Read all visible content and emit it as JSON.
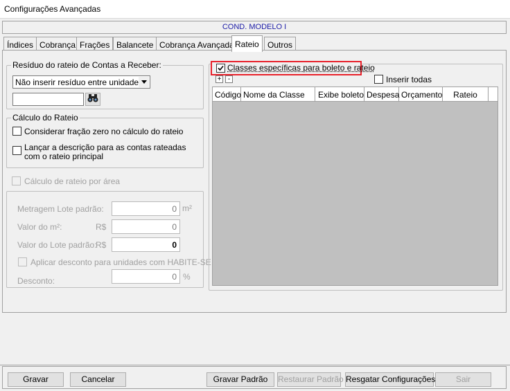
{
  "window": {
    "title": "Configurações Avançadas"
  },
  "condominium": {
    "name": "COND. MODELO I"
  },
  "tabs": [
    {
      "label": "Índices"
    },
    {
      "label": "Cobrança"
    },
    {
      "label": "Frações"
    },
    {
      "label": "Balancete"
    },
    {
      "label": "Cobrança Avançada"
    },
    {
      "label": "Rateio"
    },
    {
      "label": "Outros"
    }
  ],
  "residuo": {
    "legend": "Resíduo do rateio de Contas a Receber:",
    "selected": "Não inserir resíduo entre unidades",
    "search_value": ""
  },
  "calculo": {
    "legend": "Cálculo do Rateio",
    "fracao_zero": "Considerar fração zero no cálculo do rateio",
    "descricao_line1": "Lançar a descrição para as contas rateadas",
    "descricao_line2": "com o rateio principal"
  },
  "area": {
    "checkbox_label": "Cálculo de rateio por área",
    "metragem_label": "Metragem Lote padrão:",
    "metragem_value": "0",
    "metragem_unit": "m²",
    "valor_m2_label": "Valor do m²:",
    "valor_m2_currency": "R$",
    "valor_m2_value": "0",
    "valor_lote_label": "Valor do Lote padrão:",
    "valor_lote_currency": "R$",
    "valor_lote_value": "0",
    "habite_se_label": "Aplicar desconto para unidades com HABITE-SE",
    "desconto_label": "Desconto:",
    "desconto_value": "0",
    "desconto_unit": "%"
  },
  "classes": {
    "checkbox_label": "Classes específicas para boleto e rateio",
    "checked": true,
    "inserir_todas": "Inserir todas",
    "plus": "+",
    "minus": "-",
    "columns": [
      "Código",
      "Nome da Classe",
      "Exibe boleto",
      "Despesa",
      "Orçamento",
      "Rateio"
    ]
  },
  "buttons": {
    "gravar": "Gravar",
    "cancelar": "Cancelar",
    "gravar_padrao": "Gravar Padrão",
    "restaurar_padrao": "Restaurar Padrão",
    "resgatar": "Resgatar Configurações",
    "sair": "Sair"
  }
}
